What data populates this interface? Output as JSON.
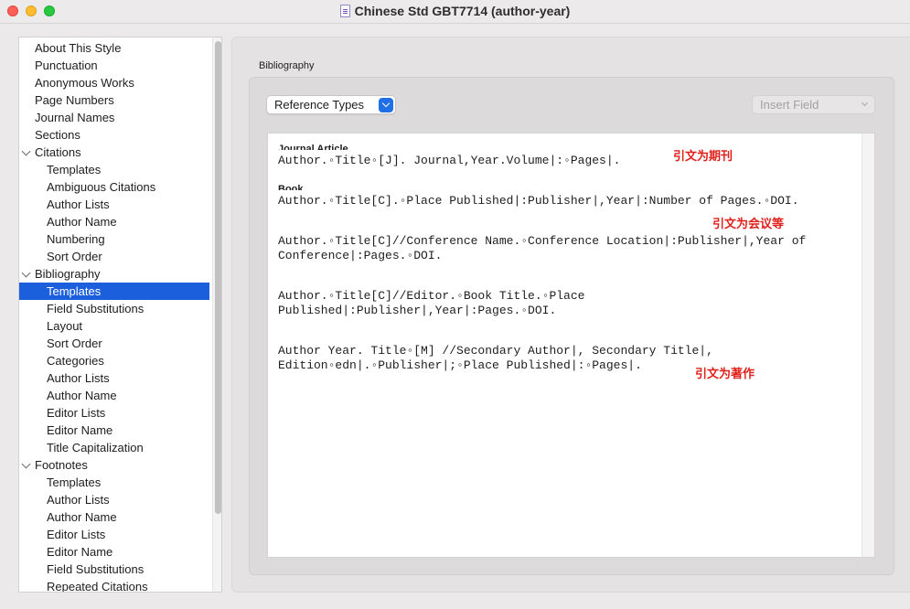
{
  "window": {
    "title": "Chinese Std GBT7714 (author-year)",
    "icon": "style-document-icon"
  },
  "sidebar": {
    "items": [
      {
        "label": "About This Style",
        "level": 0
      },
      {
        "label": "Punctuation",
        "level": 0
      },
      {
        "label": "Anonymous Works",
        "level": 0
      },
      {
        "label": "Page Numbers",
        "level": 0
      },
      {
        "label": "Journal Names",
        "level": 0
      },
      {
        "label": "Sections",
        "level": 0
      },
      {
        "label": "Citations",
        "level": 0,
        "expanded": true
      },
      {
        "label": "Templates",
        "level": 1
      },
      {
        "label": "Ambiguous Citations",
        "level": 1
      },
      {
        "label": "Author Lists",
        "level": 1
      },
      {
        "label": "Author Name",
        "level": 1
      },
      {
        "label": "Numbering",
        "level": 1
      },
      {
        "label": "Sort Order",
        "level": 1
      },
      {
        "label": "Bibliography",
        "level": 0,
        "expanded": true
      },
      {
        "label": "Templates",
        "level": 1,
        "selected": true
      },
      {
        "label": "Field Substitutions",
        "level": 1
      },
      {
        "label": "Layout",
        "level": 1
      },
      {
        "label": "Sort Order",
        "level": 1
      },
      {
        "label": "Categories",
        "level": 1
      },
      {
        "label": "Author Lists",
        "level": 1
      },
      {
        "label": "Author Name",
        "level": 1
      },
      {
        "label": "Editor Lists",
        "level": 1
      },
      {
        "label": "Editor Name",
        "level": 1
      },
      {
        "label": "Title Capitalization",
        "level": 1
      },
      {
        "label": "Footnotes",
        "level": 0,
        "expanded": true
      },
      {
        "label": "Templates",
        "level": 1
      },
      {
        "label": "Author Lists",
        "level": 1
      },
      {
        "label": "Author Name",
        "level": 1
      },
      {
        "label": "Editor Lists",
        "level": 1
      },
      {
        "label": "Editor Name",
        "level": 1
      },
      {
        "label": "Field Substitutions",
        "level": 1
      },
      {
        "label": "Repeated Citations",
        "level": 1
      }
    ]
  },
  "panel": {
    "section_label": "Bibliography",
    "reference_types_label": "Reference Types",
    "insert_field_label": "Insert Field"
  },
  "templates": {
    "journal_type": "Journal Article",
    "journal_line": "Author.◦Title◦[J]. Journal,Year.Volume|:◦Pages|.",
    "book_type": "Book",
    "book_line": "Author.◦Title[C].◦Place Published|:Publisher|,Year|:Number of Pages.◦DOI.",
    "conference_line1": "Author.◦Title[C]//Conference Name.◦Conference Location|:Publisher|,Year of",
    "conference_line2": "Conference|:Pages.◦DOI.",
    "edited_line1": "Author.◦Title[C]//Editor.◦Book Title.◦Place",
    "edited_line2": "Published|:Publisher|,Year|:Pages.◦DOI.",
    "monograph_line1": "Author Year. Title◦[M] //Secondary Author|, Secondary Title|,",
    "monograph_line2": "Edition◦edn|.◦Publisher|;◦Place Published|:◦Pages|."
  },
  "annotations": {
    "journal": "引文为期刊",
    "conference": "引文为会议等",
    "monograph": "引文为著作",
    "color": "#e0201b"
  },
  "colors": {
    "selection": "#1c5fdd",
    "accent": "#1f6fe6"
  }
}
